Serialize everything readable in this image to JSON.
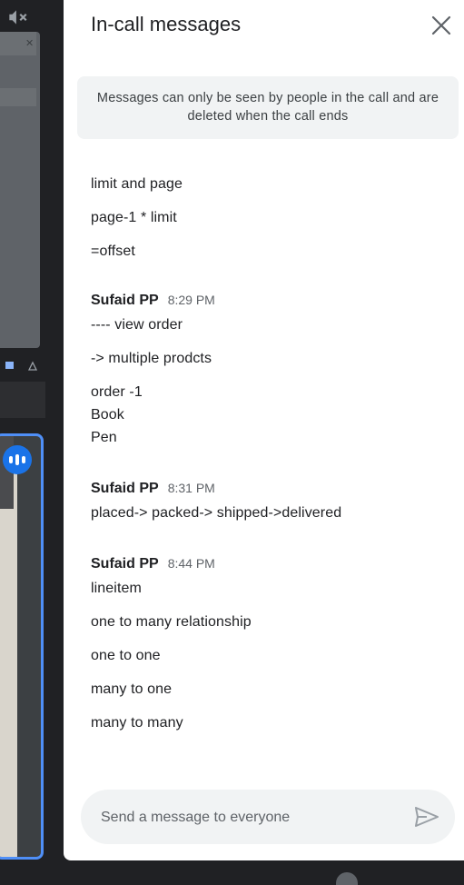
{
  "panel": {
    "title": "In-call messages",
    "close_icon": "close-icon",
    "notice": "Messages can only be seen by people in the call and are deleted when the call ends"
  },
  "message_groups": [
    {
      "sender": "",
      "time": "",
      "messages": [
        "limit and page",
        "page-1 * limit",
        "=offset"
      ]
    },
    {
      "sender": "Sufaid PP",
      "time": "8:29 PM",
      "messages": [
        "---- view order",
        "-> multiple prodcts",
        "order -1\nBook\nPen"
      ]
    },
    {
      "sender": "Sufaid PP",
      "time": "8:31 PM",
      "messages": [
        "placed-> packed-> shipped->delivered"
      ]
    },
    {
      "sender": "Sufaid PP",
      "time": "8:44 PM",
      "messages": [
        "lineitem",
        "one to many relationship",
        "one to one",
        "many to one",
        "many to many"
      ]
    }
  ],
  "composer": {
    "placeholder": "Send a message to everyone",
    "send_icon": "send-icon"
  },
  "background": {
    "mic_icon": "mic-off-icon",
    "speaker_indicator": "speaking-indicator-icon",
    "accent": "#4f8ff7"
  }
}
